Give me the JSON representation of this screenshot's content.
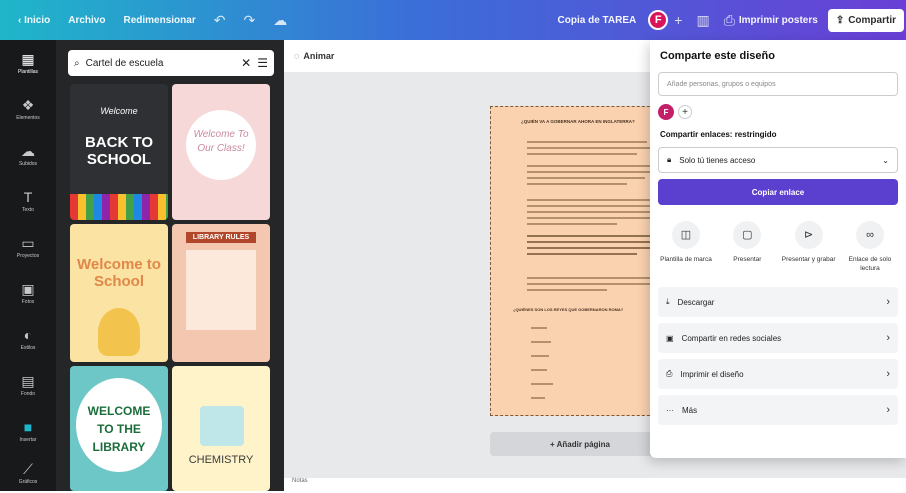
{
  "topbar": {
    "back_label": "Inicio",
    "file_label": "Archivo",
    "resize_label": "Redimensionar",
    "doc_title": "Copia de TAREA",
    "avatar_initial": "F",
    "print_label": "Imprimir posters",
    "share_label": "Compartir"
  },
  "rail": [
    {
      "label": "Plantillas",
      "icon": "template-icon"
    },
    {
      "label": "Elementos",
      "icon": "elements-icon"
    },
    {
      "label": "Subidos",
      "icon": "upload-icon"
    },
    {
      "label": "Texto",
      "icon": "text-icon"
    },
    {
      "label": "Proyectos",
      "icon": "folder-icon"
    },
    {
      "label": "Fotos",
      "icon": "photo-icon"
    },
    {
      "label": "Estilos",
      "icon": "styles-icon"
    },
    {
      "label": "Fondo",
      "icon": "background-icon"
    },
    {
      "label": "Insertar",
      "icon": "insert-icon"
    },
    {
      "label": "Gráficos",
      "icon": "charts-icon"
    }
  ],
  "search": {
    "value": "Cartel de escuela"
  },
  "templates": [
    {
      "title": "BACK TO SCHOOL",
      "subtitle": "Welcome",
      "bg": "#2f3033",
      "color": "#ffffff"
    },
    {
      "title": "Welcome To Our Class!",
      "subtitle": "",
      "bg": "#f6d8d8",
      "color": "#c98aa0"
    },
    {
      "title": "Welcome to School",
      "subtitle": "",
      "bg": "#fbe3a3",
      "color": "#e0874a"
    },
    {
      "title": "LIBRARY RULES",
      "subtitle": "",
      "bg": "#f4c7b0",
      "color": "#b2462a"
    },
    {
      "title": "WELCOME TO THE LIBRARY",
      "subtitle": "",
      "bg": "#ffffff",
      "color": "#1c6d3c"
    },
    {
      "title": "CHEMISTRY",
      "subtitle": "",
      "bg": "#fff3c9",
      "color": "#3a3a3a"
    }
  ],
  "canvas": {
    "animate_label": "Animar",
    "heading": "¿QUIÉN VA A GOBERNAR AHORA EN INGLATERRA?",
    "subheading": "¿QUIÉNES SON LOS REYES QUE GOBERNARON ROMA?",
    "add_page_label": "+ Añadir página",
    "notes_label": "Notas"
  },
  "share_panel": {
    "title": "Comparte este diseño",
    "people_placeholder": "Añade personas, grupos o equipos",
    "avatar_initial": "F",
    "links_label": "Compartir enlaces: restringido",
    "access_value": "Solo tú tienes acceso",
    "copy_label": "Copiar enlace",
    "options": [
      {
        "label": "Plantilla de marca",
        "icon": "template-icon"
      },
      {
        "label": "Presentar",
        "icon": "present-icon"
      },
      {
        "label": "Presentar y grabar",
        "icon": "record-icon"
      },
      {
        "label": "Enlace de solo lectura",
        "icon": "link-icon"
      }
    ],
    "rows": [
      {
        "label": "Descargar",
        "icon": "download-icon"
      },
      {
        "label": "Compartir en redes sociales",
        "icon": "social-icon"
      },
      {
        "label": "Imprimir el diseño",
        "icon": "print-icon"
      },
      {
        "label": "Más",
        "icon": "more-icon"
      }
    ]
  }
}
